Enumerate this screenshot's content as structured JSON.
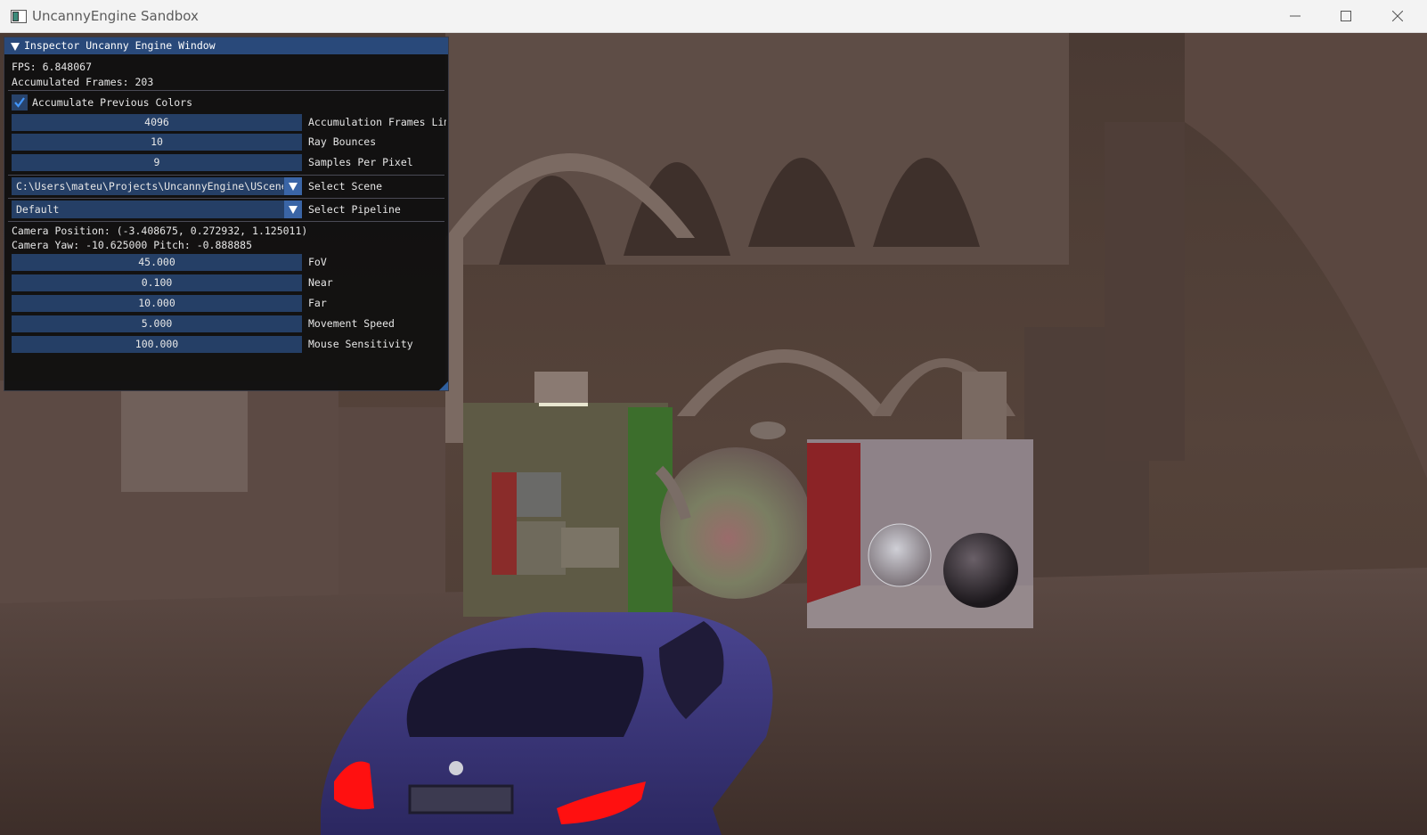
{
  "window": {
    "title": "UncannyEngine Sandbox",
    "controls": {
      "minimize_icon": "minimize-icon",
      "maximize_icon": "maximize-icon",
      "close_icon": "close-icon"
    }
  },
  "inspector": {
    "title": "Inspector Uncanny Engine Window",
    "fps_text": "FPS: 6.848067",
    "accumulated_frames_text": "Accumulated Frames: 203",
    "accumulate_checkbox": {
      "label": "Accumulate Previous Colors",
      "checked": true
    },
    "render_fields": [
      {
        "value": "4096",
        "label": "Accumulation Frames Limit"
      },
      {
        "value": "10",
        "label": "Ray Bounces"
      },
      {
        "value": "9",
        "label": "Samples Per Pixel"
      }
    ],
    "scene_select": {
      "value": "C:\\Users\\mateu\\Projects\\UncannyEngine\\UScene",
      "label": "Select Scene"
    },
    "pipeline_select": {
      "value": "Default",
      "label": "Select Pipeline"
    },
    "camera_position_text": "Camera Position: (-3.408675, 0.272932, 1.125011)",
    "camera_angles_text": "Camera Yaw: -10.625000 Pitch: -0.888885",
    "camera_fields": [
      {
        "value": "45.000",
        "label": "FoV"
      },
      {
        "value": "0.100",
        "label": "Near"
      },
      {
        "value": "10.000",
        "label": "Far"
      },
      {
        "value": "5.000",
        "label": "Movement Speed"
      },
      {
        "value": "100.000",
        "label": "Mouse Sensitivity"
      }
    ]
  },
  "colors": {
    "header_bg": "#29497a",
    "field_bg": "#253f66",
    "accent": "#4296fa",
    "panel_bg": "#0f0f0f"
  }
}
